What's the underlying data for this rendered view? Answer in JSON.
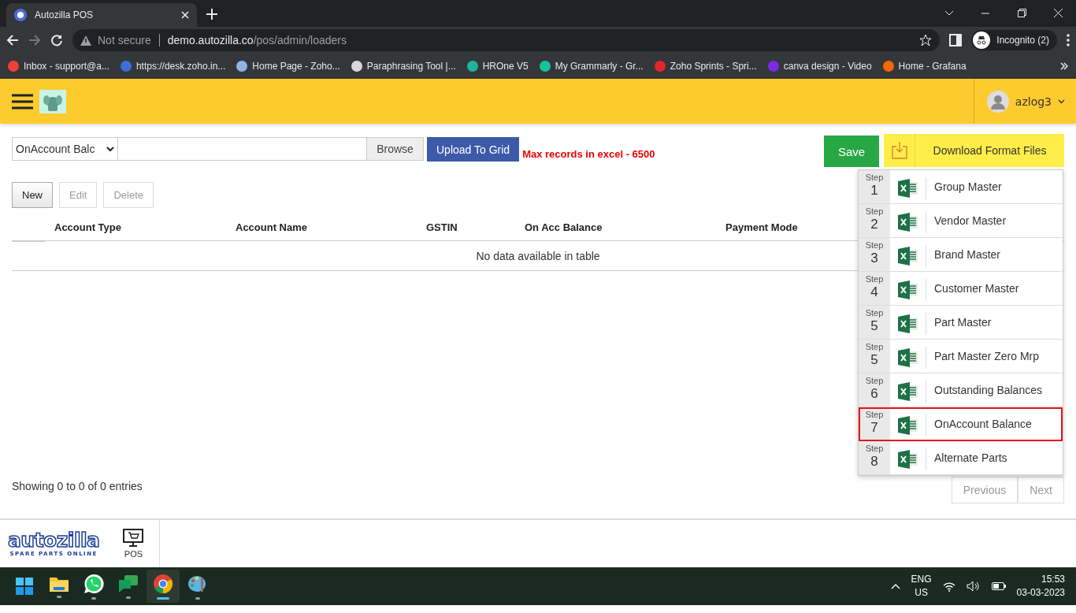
{
  "browser": {
    "tab_title": "Autozilla POS",
    "security": "Not secure",
    "url_host": "demo.autozilla.co",
    "url_path": "/pos/admin/loaders",
    "profile": "Incognito (2)",
    "bookmarks": [
      {
        "title": "Inbox - support@a...",
        "color": "#ea4335"
      },
      {
        "title": "https://desk.zoho.in...",
        "color": "#3b6fd8"
      },
      {
        "title": "Home Page - Zoho...",
        "color": "#8fb4e8"
      },
      {
        "title": "Paraphrasing Tool |...",
        "color": "#d8d8d8"
      },
      {
        "title": "HROne V5",
        "color": "#1fb59a"
      },
      {
        "title": "My Grammarly - Gr...",
        "color": "#15c39a"
      },
      {
        "title": "Zoho Sprints - Spri...",
        "color": "#e42527"
      },
      {
        "title": "canva design - Video",
        "color": "#7d2ae8"
      },
      {
        "title": "Home - Grafana",
        "color": "#f46800"
      }
    ]
  },
  "header": {
    "user": "azlog3"
  },
  "loader": {
    "select_value": "OnAccount Balc",
    "browse": "Browse",
    "upload": "Upload To Grid",
    "note": "Max records in excel - 6500",
    "save": "Save",
    "download": "Download Format Files"
  },
  "actions": [
    {
      "label": "New",
      "disabled": false
    },
    {
      "label": "Edit",
      "disabled": true
    },
    {
      "label": "Delete",
      "disabled": true
    }
  ],
  "table": {
    "columns": [
      "Account Type",
      "Account Name",
      "GSTIN",
      "On Acc Balance",
      "Payment Mode"
    ],
    "empty": "No data available in table",
    "info": "Showing 0 to 0 of 0 entries",
    "pagination": [
      "Previous",
      "Next"
    ]
  },
  "format_files": [
    {
      "step_label": "Step",
      "step": "1",
      "name": "Group Master",
      "selected": false
    },
    {
      "step_label": "Step",
      "step": "2",
      "name": "Vendor Master",
      "selected": false
    },
    {
      "step_label": "Step",
      "step": "3",
      "name": "Brand Master",
      "selected": false
    },
    {
      "step_label": "Step",
      "step": "4",
      "name": "Customer Master",
      "selected": false
    },
    {
      "step_label": "Step",
      "step": "5",
      "name": "Part Master",
      "selected": false
    },
    {
      "step_label": "Step",
      "step": "5",
      "name": "Part Master Zero Mrp",
      "selected": false
    },
    {
      "step_label": "Step",
      "step": "6",
      "name": "Outstanding Balances",
      "selected": false
    },
    {
      "step_label": "Step",
      "step": "7",
      "name": "OnAccount Balance",
      "selected": true
    },
    {
      "step_label": "Step",
      "step": "8",
      "name": "Alternate Parts",
      "selected": false
    }
  ],
  "footer": {
    "brand": "autozilla",
    "tagline": "SPARE PARTS ONLINE",
    "nav": [
      {
        "label": "POS"
      }
    ]
  },
  "taskbar": {
    "apps": [
      {
        "kind": "start",
        "selected": false
      },
      {
        "kind": "files",
        "selected": false
      },
      {
        "kind": "whatsapp",
        "selected": false
      },
      {
        "kind": "chat",
        "selected": false
      },
      {
        "kind": "chrome",
        "selected": true
      },
      {
        "kind": "paint",
        "selected": false
      }
    ],
    "language": "ENG",
    "region": "US",
    "time": "15:53",
    "date": "03-03-2023"
  }
}
